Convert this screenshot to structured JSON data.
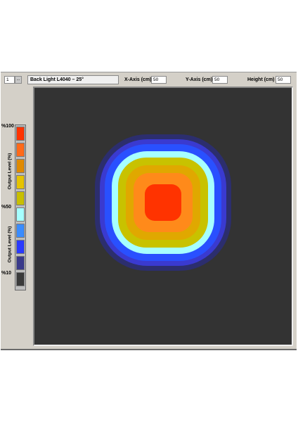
{
  "toolbar": {
    "counter_value": "1",
    "counter_button": "...",
    "title": "Back Light L4040 – 25°",
    "x_axis_label": "X-Axis (cm)",
    "x_axis_value": "50",
    "y_axis_label": "Y-Axis (cm)",
    "y_axis_value": "50",
    "height_label": "Height (cm)",
    "height_value": "50"
  },
  "legend": {
    "top_percent": "%100",
    "mid_percent": "%50",
    "bottom_percent": "%10",
    "axis_label_upper": "Output Level (%)",
    "axis_label_lower": "Output Level (%)",
    "swatches": [
      "#ff3300",
      "#ff6a1a",
      "#e08a00",
      "#e6c300",
      "#c8bf00",
      "#a6ffff",
      "#3a8cff",
      "#2a3aff",
      "#3a3a8a",
      "#3a3a3a"
    ]
  },
  "plot": {
    "background": "#333333",
    "contour_colors": [
      "#2c2e6e",
      "#3a3ad0",
      "#2950ff",
      "#a6ffff",
      "#c8c200",
      "#e0a800",
      "#ff8a1a",
      "#ff3300"
    ]
  }
}
